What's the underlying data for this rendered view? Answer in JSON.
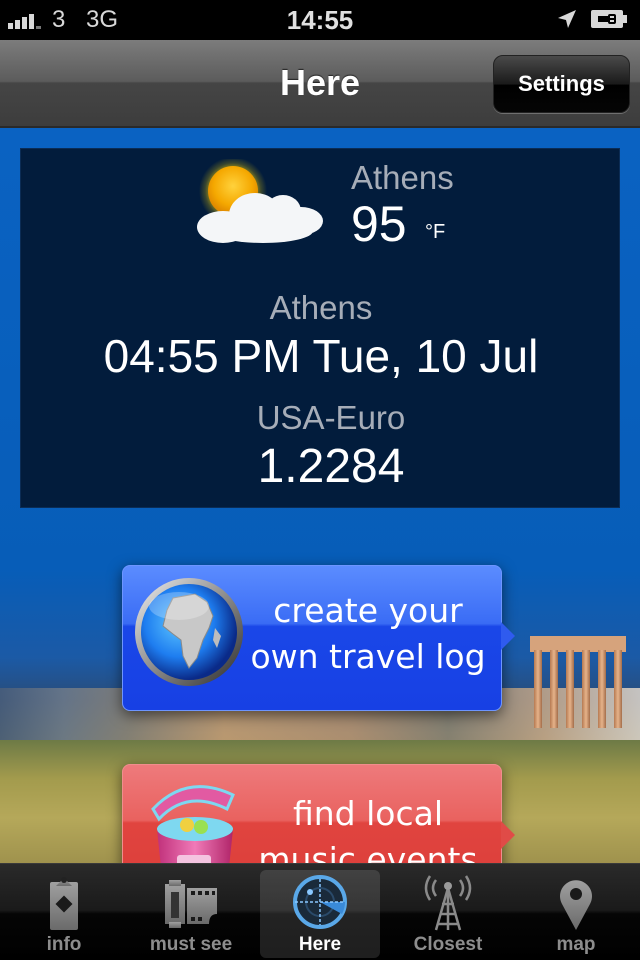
{
  "status_bar": {
    "signal_bars": 4,
    "carrier": "3",
    "network": "3G",
    "time": "14:55",
    "icons": [
      "signal-icon",
      "location-arrow-icon",
      "battery-charging-icon"
    ]
  },
  "nav": {
    "title": "Here",
    "settings_label": "Settings"
  },
  "weather": {
    "icon": "partly-cloudy-icon",
    "city": "Athens",
    "temperature": "95",
    "unit": "°F"
  },
  "clock": {
    "city": "Athens",
    "datetime": "04:55 PM Tue, 10 Jul"
  },
  "currency": {
    "pair": "USA-Euro",
    "rate": "1.2284"
  },
  "promos": [
    {
      "line1": "create your",
      "line2": "own travel log",
      "icon": "globe-icon",
      "color": "#1a47e8"
    },
    {
      "line1": "find local",
      "line2": "music events",
      "icon": "cooler-icon",
      "color": "#e0443f"
    }
  ],
  "tabs": [
    {
      "label": "info",
      "icon": "clipboard-icon",
      "active": false
    },
    {
      "label": "must see",
      "icon": "film-roll-icon",
      "active": false
    },
    {
      "label": "Here",
      "icon": "radar-icon",
      "active": true
    },
    {
      "label": "Closest",
      "icon": "antenna-tower-icon",
      "active": false
    },
    {
      "label": "map",
      "icon": "map-pin-icon",
      "active": false
    }
  ]
}
